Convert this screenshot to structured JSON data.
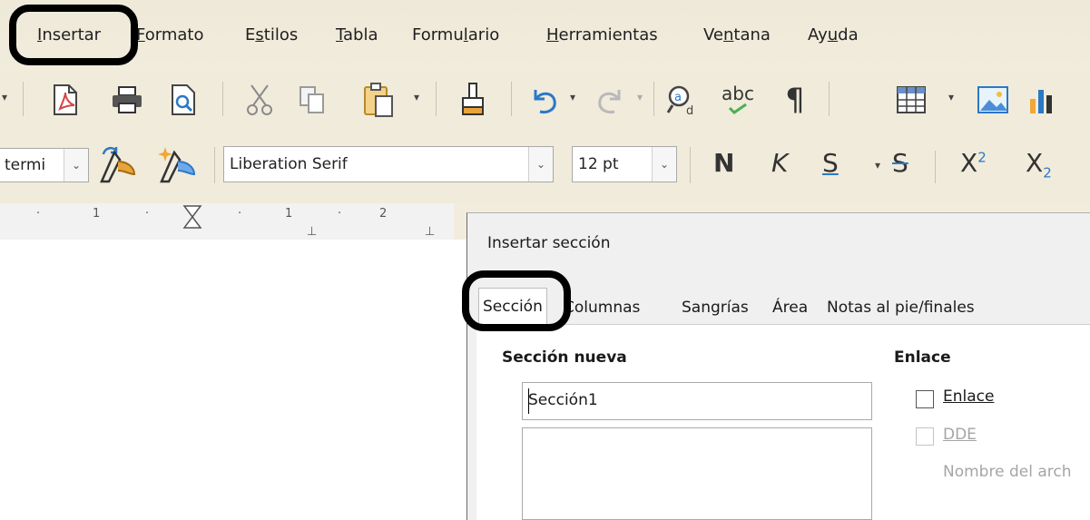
{
  "menu": {
    "items": [
      {
        "label": "Insertar",
        "mnemonic": "I"
      },
      {
        "label": "Formato",
        "mnemonic": "F"
      },
      {
        "label": "Estilos",
        "mnemonic": "s"
      },
      {
        "label": "Tabla",
        "mnemonic": "T"
      },
      {
        "label": "Formulario",
        "mnemonic": "l"
      },
      {
        "label": "Herramientas",
        "mnemonic": "H"
      },
      {
        "label": "Ventana",
        "mnemonic": "n"
      },
      {
        "label": "Ayuda",
        "mnemonic": "u"
      }
    ]
  },
  "toolbar": {
    "icons": [
      "export-pdf-icon",
      "print-icon",
      "print-preview-icon",
      "cut-icon",
      "copy-icon",
      "paste-icon",
      "clone-formatting-icon",
      "undo-icon",
      "redo-icon",
      "find-replace-icon",
      "spelling-icon",
      "formatting-marks-icon",
      "insert-table-icon",
      "insert-image-icon",
      "insert-chart-icon"
    ],
    "spelling_glyph": "abc",
    "formatting_marks_glyph": "¶"
  },
  "formatting": {
    "paragraph_style_value": "termi",
    "font_name": "Liberation Serif",
    "font_size": "12 pt",
    "bold_label": "N",
    "italic_label": "K",
    "underline_label": "S",
    "strikethrough_label": "S",
    "superscript_label": "X",
    "superscript_mark": "2",
    "subscript_label": "X",
    "subscript_mark": "2"
  },
  "ruler": {
    "labels": [
      "1",
      "1",
      "2"
    ]
  },
  "dialog": {
    "title": "Insertar sección",
    "tabs": [
      "Sección",
      "Columnas",
      "Sangrías",
      "Área",
      "Notas al pie/finales"
    ],
    "active_tab": "Sección",
    "new_section_heading": "Sección nueva",
    "section_name_value": "Sección1",
    "link_heading": "Enlace",
    "link_checkbox_label": "Enlace",
    "link_checked": false,
    "dde_checkbox_label": "DDE",
    "dde_checked": false,
    "filename_label": "Nombre del arch"
  },
  "colors": {
    "chrome_background": "#f0ebdb",
    "dialog_background": "#f0f0f0",
    "highlight_ring": "#000000",
    "pdf_red": "#d64545",
    "icon_blue": "#2b78c8"
  }
}
